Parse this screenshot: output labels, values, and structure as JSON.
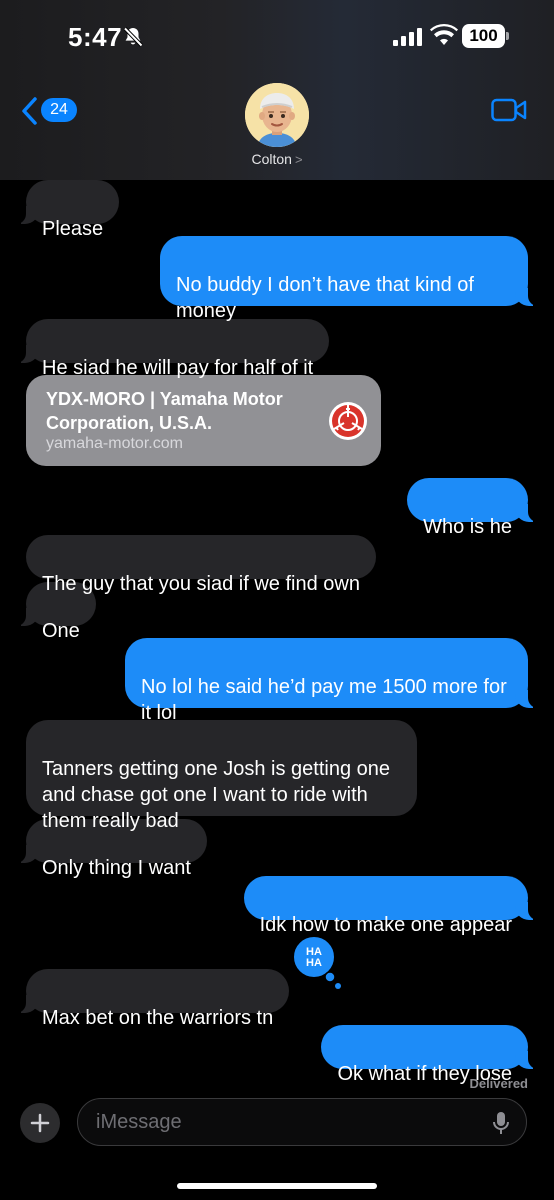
{
  "status_bar": {
    "time": "5:47",
    "battery": "100"
  },
  "nav": {
    "back_count": "24",
    "contact_name": "Colton",
    "contact_chevron": ">"
  },
  "messages": [
    {
      "side": "in",
      "text": "Please"
    },
    {
      "side": "out",
      "text": "No buddy I don’t have that kind of money"
    },
    {
      "side": "in",
      "text": "He siad he will pay for half of it"
    },
    {
      "side": "out",
      "text": "Who is he"
    },
    {
      "side": "in",
      "text": "The guy that you siad if we find own"
    },
    {
      "side": "in",
      "text": "One"
    },
    {
      "side": "out",
      "text": "No lol he said he’d pay me 1500 more for it lol"
    },
    {
      "side": "in",
      "text": "Tanners getting one Josh is getting one and chase got one I want to ride with them really bad"
    },
    {
      "side": "in",
      "text": "Only thing I want"
    },
    {
      "side": "out",
      "text": "Idk how to make one appear"
    },
    {
      "side": "in",
      "text": "Max bet on the warriors tn",
      "tapback": "HA HA"
    },
    {
      "side": "out",
      "text": "Ok what if they lose"
    }
  ],
  "link_preview": {
    "title": "YDX-MORO | Yamaha Motor Corporation, U.S.A.",
    "url": "yamaha-motor.com",
    "logo_icon": "yamaha-logo"
  },
  "delivery_status": "Delivered",
  "composer": {
    "placeholder": "iMessage"
  },
  "colors": {
    "outgoing": "#1d8cf8",
    "incoming": "#262629",
    "accent": "#0a84ff"
  }
}
